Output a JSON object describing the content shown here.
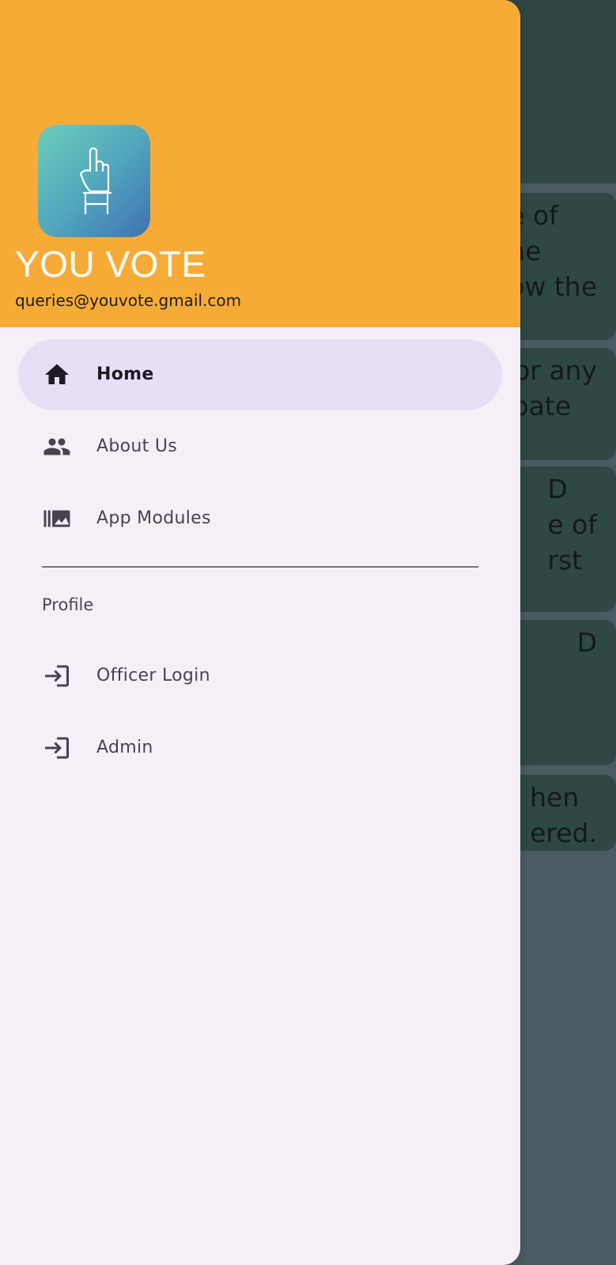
{
  "drawer": {
    "app_name": "YOU VOTE",
    "email": "queries@youvote.gmail.com",
    "logo_icon": "raised-finger-vote-icon",
    "nav_items": [
      {
        "label": "Home",
        "icon": "home-icon",
        "active": true
      },
      {
        "label": "About Us",
        "icon": "people-icon",
        "active": false
      },
      {
        "label": "App Modules",
        "icon": "photo-library-icon",
        "active": false
      }
    ],
    "section_label": "Profile",
    "profile_items": [
      {
        "label": "Officer Login",
        "icon": "login-icon"
      },
      {
        "label": "Admin",
        "icon": "login-icon"
      }
    ]
  },
  "background": {
    "cards": [
      {
        "text": "e of\nhe\now the"
      },
      {
        "text": "for any\nipate"
      },
      {
        "text": "D\ne of\nrst"
      },
      {
        "text": "D"
      },
      {
        "text": "hen\nered."
      }
    ]
  },
  "colors": {
    "header": "#f7ab37",
    "drawer_bg": "#f5f0f7",
    "active_pill": "#e6dff6",
    "scrim_card": "#2f4845"
  }
}
